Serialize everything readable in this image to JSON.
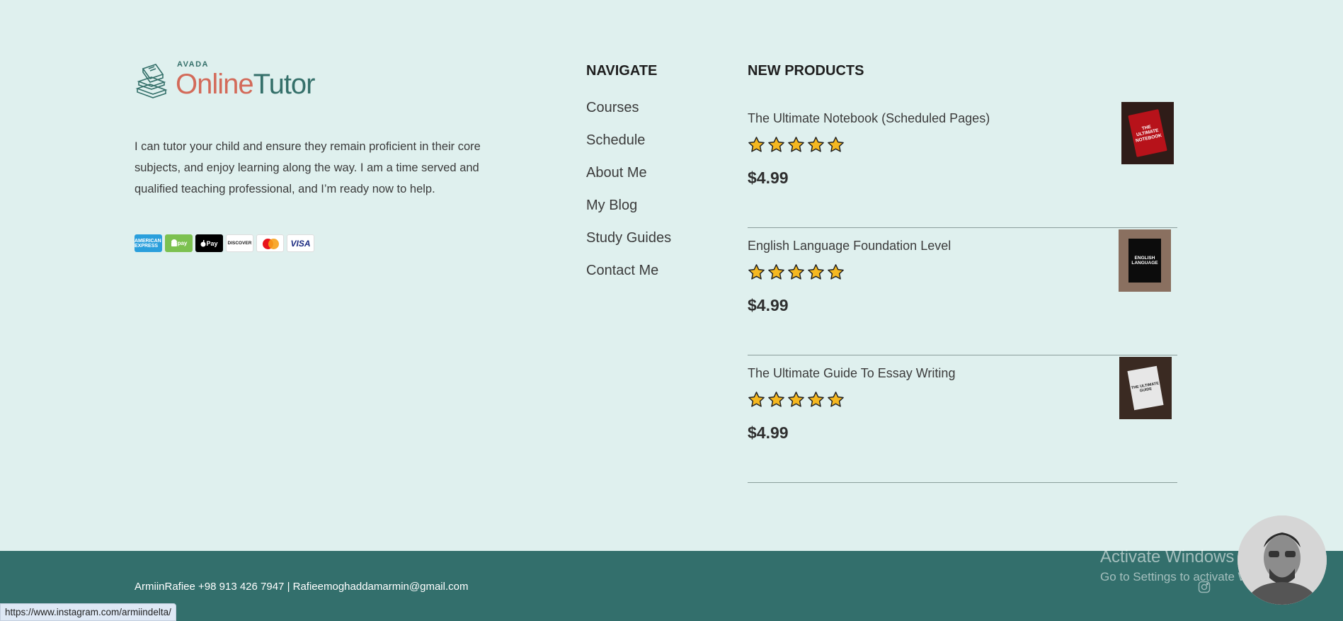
{
  "logo": {
    "small": "AVADA",
    "online": "Online",
    "tutor": "Tutor"
  },
  "intro": "I can tutor your child and ensure they remain proficient in their core subjects, and enjoy learning along the way. I am a time served and qualified teaching professional, and I’m ready now to help.",
  "payments": {
    "amex": "AMERICAN EXPRESS",
    "android": "pay",
    "apple": "Pay",
    "discover": "DISCOVER",
    "visa": "VISA"
  },
  "navigate": {
    "heading": "NAVIGATE",
    "items": [
      "Courses",
      "Schedule",
      "About Me",
      "My Blog",
      "Study Guides",
      "Contact Me"
    ]
  },
  "new_products": {
    "heading": "NEW PRODUCTS",
    "items": [
      {
        "title": "The Ultimate Notebook (Scheduled Pages)",
        "price": "$4.99",
        "rating": 5,
        "cover_text": "THE ULTIMATE NOTEBOOK"
      },
      {
        "title": "English Language Foundation Level",
        "price": "$4.99",
        "rating": 5,
        "cover_text": "ENGLISH LANGUAGE"
      },
      {
        "title": "The Ultimate Guide To Essay Writing",
        "price": "$4.99",
        "rating": 5,
        "cover_text": "THE ULTIMATE GUIDE"
      }
    ]
  },
  "footer": {
    "contact": "ArmiinRafiee +98 913 426 7947 | Rafieemoghaddamarmin@gmail.com"
  },
  "status_url": "https://www.instagram.com/armiindelta/",
  "watermark": {
    "title": "Activate Windows",
    "subtitle": "Go to Settings to activate Windows."
  },
  "colors": {
    "background": "#dff0ee",
    "footer": "#336f6c",
    "logo_online": "#d36a59",
    "logo_tutor": "#35706a",
    "star": "#f5b820"
  }
}
